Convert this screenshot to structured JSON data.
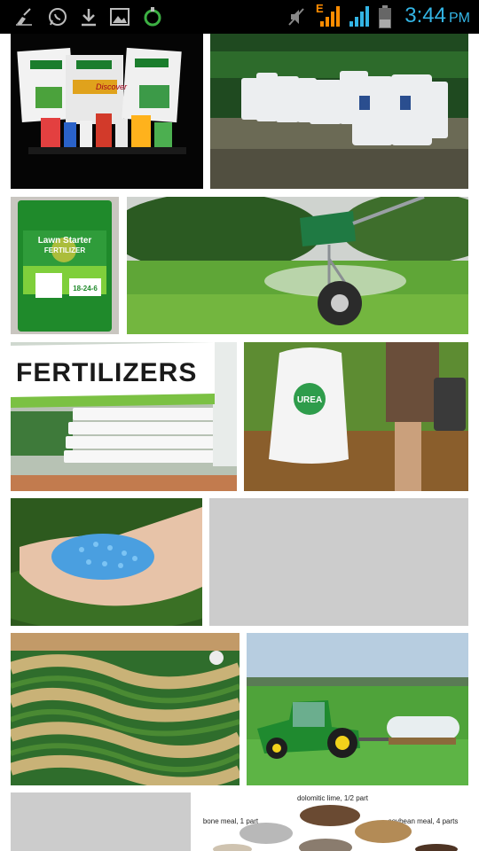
{
  "status_bar": {
    "time": "3:44",
    "ampm": "PM",
    "network_type": "E",
    "icons": [
      "cleaner-icon",
      "whatsapp-icon",
      "download-icon",
      "gallery-icon",
      "battery-saver-icon",
      "mute-icon",
      "signal-icon",
      "signal-icon-2",
      "battery-icon"
    ]
  },
  "colors": {
    "status_bar_bg": "#000000",
    "clock": "#33b5e5",
    "placeholder": "#cccccc"
  },
  "results": {
    "tiles": [
      {
        "subject": "fertilizer product bags on black background",
        "labels": [
          "Discover"
        ]
      },
      {
        "subject": "white bulk fertilizer bags in field"
      },
      {
        "subject": "lawn starter fertilizer bag",
        "labels": [
          "Lawn Starter",
          "FERTILIZER",
          "18-24-6"
        ]
      },
      {
        "subject": "green broadcast spreader on lawn"
      },
      {
        "subject": "fertilizers banner with stacked bags",
        "labels": [
          "FERTILIZERS"
        ]
      },
      {
        "subject": "urea bag in farm field",
        "labels": [
          "UREA"
        ]
      },
      {
        "subject": "hand holding blue granules"
      },
      {
        "subject": "image placeholder (loading)"
      },
      {
        "subject": "aerial contour farmland"
      },
      {
        "subject": "green tractor with tank in field"
      },
      {
        "subject": "image placeholder (loading)"
      },
      {
        "subject": "soil amendment ingredients chart",
        "labels": [
          "dolomitic lime, 1/2 part",
          "bone meal, 1 part",
          "soybean meal, 4 parts"
        ]
      }
    ]
  }
}
